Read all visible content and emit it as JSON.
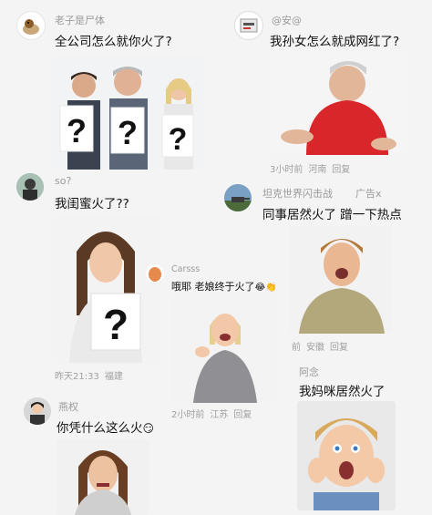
{
  "posts": [
    {
      "user": "老子是尸体",
      "text": "全公司怎么就你火了?"
    },
    {
      "user": "@安@",
      "text": "我孙女怎么就成网红了?",
      "time": "3小时前",
      "loc": "河南",
      "reply": "回复"
    },
    {
      "user": "so?",
      "text": "我闺蜜火了??",
      "time": "昨天21:33",
      "loc": "福建"
    },
    {
      "user": "坦克世界闪击战",
      "ad": "广告x",
      "text": "同事居然火了 蹭一下热点",
      "time": "前",
      "loc": "安徽",
      "reply": "回复"
    },
    {
      "user": "Carsss",
      "text": "哦耶 老娘终于火了",
      "time": "2小时前",
      "loc": "江苏",
      "reply": "回复"
    },
    {
      "user": "阿念",
      "text": "我妈咪居然火了"
    },
    {
      "user": "燕权",
      "text": "你凭什么这么火"
    }
  ],
  "icons": {
    "emoji1": "laughing-emoji-icon",
    "emoji2": "clap-emoji-icon",
    "emoji3": "grin-emoji-icon"
  }
}
